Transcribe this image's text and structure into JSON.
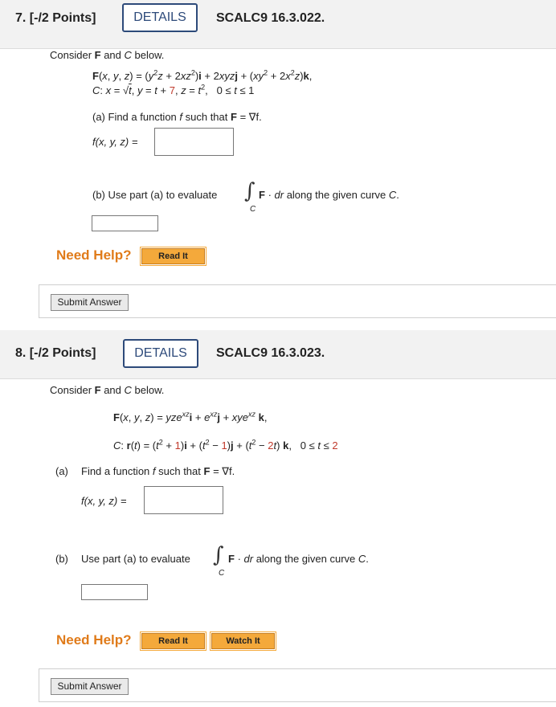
{
  "q7": {
    "number": "7.  [-/2 Points]",
    "details": "DETAILS",
    "code": "SCALC9 16.3.022.",
    "intro_prefix": "Consider ",
    "intro_F": "F",
    "intro_and": " and ",
    "intro_C": "C",
    "intro_suffix": " below.",
    "part_a_prefix": "(a) Find a function ",
    "part_a_f": "f",
    "part_a_mid": " such that ",
    "part_a_F": "F",
    "part_a_end": " = ∇f.",
    "fxyz_label": "f(x, y, z)  =",
    "part_b_prefix": "(b) Use part (a) to evaluate",
    "part_b_F": "F",
    "part_b_dot": " · ",
    "part_b_dr": "dr",
    "part_b_suffix": " along the given curve ",
    "part_b_C": "C",
    "part_b_period": ".",
    "need_help": "Need Help?",
    "read_it": "Read It",
    "submit": "Submit Answer"
  },
  "q8": {
    "number": "8.  [-/2 Points]",
    "details": "DETAILS",
    "code": "SCALC9 16.3.023.",
    "intro_prefix": "Consider ",
    "intro_F": "F",
    "intro_and": " and ",
    "intro_C": "C",
    "intro_suffix": " below.",
    "part_a_label": "(a)",
    "part_a_prefix": "Find a function ",
    "part_a_f": "f",
    "part_a_mid": " such that ",
    "part_a_F": "F",
    "part_a_end": " = ∇f.",
    "fxyz_label": "f(x, y, z)  =",
    "part_b_label": "(b)",
    "part_b_prefix": "Use part (a) to evaluate",
    "part_b_F": "F",
    "part_b_dot": " · ",
    "part_b_dr": "dr",
    "part_b_suffix": " along the given curve ",
    "part_b_C": "C",
    "part_b_period": ".",
    "need_help": "Need Help?",
    "read_it": "Read It",
    "watch_it": "Watch It",
    "submit": "Submit Answer"
  },
  "integral_symbol": "∫",
  "integral_sub": "C",
  "colors": {
    "accent_blue": "#2d4a7a",
    "help_orange": "#e07b1a",
    "button_orange": "#f4a93b",
    "param_red": "#c0392b"
  }
}
